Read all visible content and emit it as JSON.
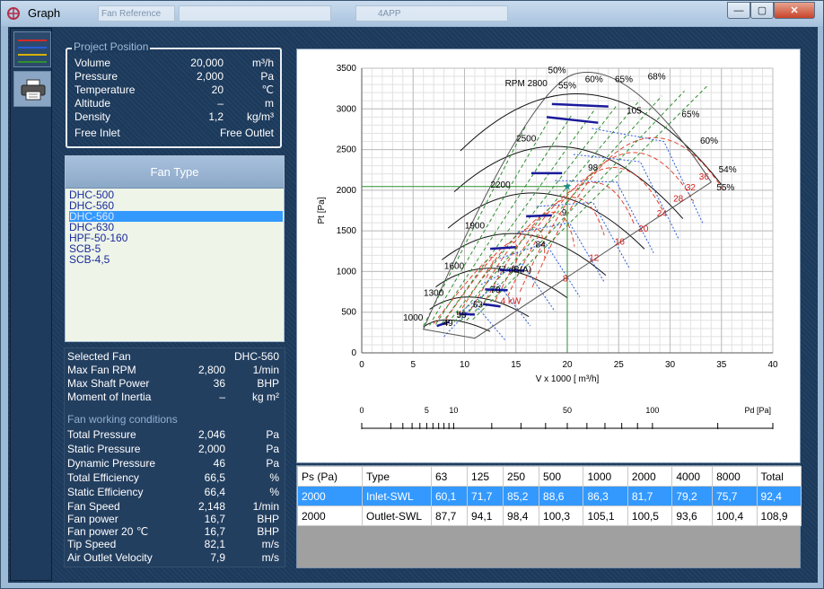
{
  "window": {
    "title": "Graph",
    "ghost_text_1": "Fan Reference",
    "ghost_text_2": "4APP"
  },
  "toolbar": {
    "legend_colors": [
      "#d62828",
      "#2a5bd7",
      "#d9b200",
      "#2f8f2f"
    ],
    "print_icon": "printer-icon"
  },
  "project": {
    "title": "Project Position",
    "rows": [
      {
        "k": "Volume",
        "v": "20,000",
        "u": "m³/h"
      },
      {
        "k": "Pressure",
        "v": "2,000",
        "u": "Pa"
      },
      {
        "k": "Temperature",
        "v": "20",
        "u": "℃"
      },
      {
        "k": "Altitude",
        "v": "–",
        "u": "m"
      },
      {
        "k": "Density",
        "v": "1,2",
        "u": "kg/m³"
      }
    ],
    "free_inlet": "Free Inlet",
    "free_outlet": "Free Outlet"
  },
  "fan_type": {
    "header": "Fan Type",
    "items": [
      "DHC-500",
      "DHC-560",
      "DHC-560",
      "DHC-630",
      "HPF-50-160",
      "SCB-5",
      "SCB-4,5"
    ],
    "selected_index": 2
  },
  "selected": {
    "rows": [
      {
        "k": "Selected Fan",
        "v": "",
        "u": "DHC-560"
      },
      {
        "k": "Max Fan RPM",
        "v": "2,800",
        "u": "1/min"
      },
      {
        "k": "Max Shaft Power",
        "v": "36",
        "u": "BHP"
      },
      {
        "k": "Moment of Inertia",
        "v": "–",
        "u": "kg m²"
      }
    ]
  },
  "conditions": {
    "title": "Fan working conditions",
    "rows": [
      {
        "k": "Total Pressure",
        "v": "2,046",
        "u": "Pa"
      },
      {
        "k": "Static Pressure",
        "v": "2,000",
        "u": "Pa"
      },
      {
        "k": "Dynamic Pressure",
        "v": "46",
        "u": "Pa"
      },
      {
        "k": "Total Efficiency",
        "v": "66,5",
        "u": "%"
      },
      {
        "k": "Static Efficiency",
        "v": "66,4",
        "u": "%"
      },
      {
        "k": "Fan Speed",
        "v": "2,148",
        "u": "1/min"
      },
      {
        "k": "Fan power",
        "v": "16,7",
        "u": "BHP"
      },
      {
        "k": "Fan power 20 ℃",
        "v": "16,7",
        "u": "BHP"
      },
      {
        "k": "Tip Speed",
        "v": "82,1",
        "u": "m/s"
      },
      {
        "k": "Air Outlet Velocity",
        "v": "7,9",
        "u": "m/s"
      }
    ]
  },
  "chart_data": {
    "type": "line",
    "xlabel": "V x 1000 [ m³/h]",
    "ylabel": "Pt [Pa]",
    "xlim": [
      0,
      40
    ],
    "ylim": [
      0,
      3500
    ],
    "xticks": [
      0,
      5,
      10,
      15,
      20,
      25,
      30,
      35,
      40
    ],
    "yticks": [
      0,
      500,
      1000,
      1500,
      2000,
      2500,
      3000,
      3500
    ],
    "operating_point": {
      "x": 20,
      "y": 2046
    },
    "rpm_labels": [
      {
        "text": "1000",
        "x": 5,
        "y": 400
      },
      {
        "text": "1300",
        "x": 7,
        "y": 700
      },
      {
        "text": "1600",
        "x": 9,
        "y": 1030
      },
      {
        "text": "1900",
        "x": 11,
        "y": 1530
      },
      {
        "text": "2200",
        "x": 13.5,
        "y": 2030
      },
      {
        "text": "2500",
        "x": 16,
        "y": 2600
      },
      {
        "text": "RPM 2800",
        "x": 16,
        "y": 3280
      }
    ],
    "eff_labels": [
      {
        "text": "50%",
        "x": 19,
        "y": 3440
      },
      {
        "text": "55%",
        "x": 20,
        "y": 3250
      },
      {
        "text": "60%",
        "x": 22.6,
        "y": 3330
      },
      {
        "text": "65%",
        "x": 25.5,
        "y": 3330
      },
      {
        "text": "68%",
        "x": 28.7,
        "y": 3360
      },
      {
        "text": "65%",
        "x": 32,
        "y": 2900
      },
      {
        "text": "60%",
        "x": 33.8,
        "y": 2570
      },
      {
        "text": "54%",
        "x": 35.6,
        "y": 2220
      },
      {
        "text": "55%",
        "x": 35.4,
        "y": 2000
      }
    ],
    "db_labels": [
      {
        "text": "49",
        "x": 8.4,
        "y": 330
      },
      {
        "text": "56",
        "x": 9.7,
        "y": 430
      },
      {
        "text": "63",
        "x": 11.3,
        "y": 560
      },
      {
        "text": "70",
        "x": 13,
        "y": 740
      },
      {
        "text": "77 dB(A)",
        "x": 14.8,
        "y": 990
      },
      {
        "text": "84",
        "x": 17.4,
        "y": 1300
      },
      {
        "text": "9",
        "x": 19.7,
        "y": 1690
      },
      {
        "text": "98",
        "x": 22.5,
        "y": 2240
      },
      {
        "text": "105",
        "x": 26.5,
        "y": 2940
      }
    ],
    "kw_labels": [
      {
        "text": "4 kW",
        "x": 14.5,
        "y": 600
      },
      {
        "text": "8",
        "x": 19.8,
        "y": 880
      },
      {
        "text": "12",
        "x": 22.6,
        "y": 1130
      },
      {
        "text": "16",
        "x": 25.1,
        "y": 1330
      },
      {
        "text": "20",
        "x": 27.4,
        "y": 1490
      },
      {
        "text": "24",
        "x": 29.2,
        "y": 1680
      },
      {
        "text": "28",
        "x": 30.8,
        "y": 1860
      },
      {
        "text": "32",
        "x": 32,
        "y": 2000
      },
      {
        "text": "36",
        "x": 33.3,
        "y": 2130
      }
    ],
    "pd_axis": {
      "label": "Pd [Pa]",
      "ticks": [
        "0",
        "5",
        "10",
        "50",
        "100"
      ]
    }
  },
  "spectrum": {
    "headers": [
      "Ps (Pa)",
      "Type",
      "63",
      "125",
      "250",
      "500",
      "1000",
      "2000",
      "4000",
      "8000",
      "Total"
    ],
    "rows": [
      [
        "2000",
        "Inlet-SWL",
        "60,1",
        "71,7",
        "85,2",
        "88,6",
        "86,3",
        "81,7",
        "79,2",
        "75,7",
        "92,4"
      ],
      [
        "2000",
        "Outlet-SWL",
        "87,7",
        "94,1",
        "98,4",
        "100,3",
        "105,1",
        "100,5",
        "93,6",
        "100,4",
        "108,9"
      ]
    ],
    "selected_row": 0
  }
}
